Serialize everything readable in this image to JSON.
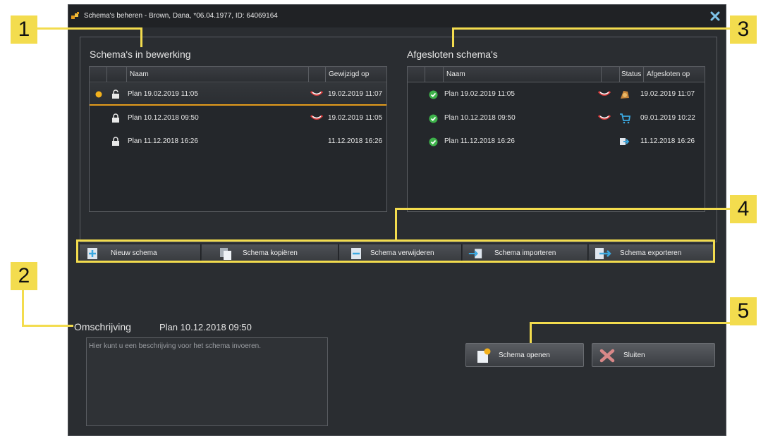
{
  "window": {
    "title": "Schema's beheren - Brown, Dana, *06.04.1977, ID: 64069164"
  },
  "left_section": {
    "title": "Schema's in bewerking",
    "columns": [
      "Naam",
      "Gewijzigd op"
    ],
    "rows": [
      {
        "name": "Plan 19.02.2019 11:05",
        "modified": "19.02.2019 11:07",
        "selected": true,
        "active_dot": true,
        "lock": "open",
        "denture_icon": true
      },
      {
        "name": "Plan 10.12.2018 09:50",
        "modified": "19.02.2019 11:05",
        "selected": false,
        "active_dot": false,
        "lock": "closed",
        "denture_icon": true
      },
      {
        "name": "Plan 11.12.2018 16:26",
        "modified": "11.12.2018 16:26",
        "selected": false,
        "active_dot": false,
        "lock": "closed",
        "denture_icon": false
      }
    ]
  },
  "right_section": {
    "title": "Afgesloten schema's",
    "columns": [
      "Naam",
      "Status",
      "Afgesloten op"
    ],
    "rows": [
      {
        "name": "Plan 19.02.2019 11:05",
        "status_icon": "print-icon",
        "closed": "19.02.2019 11:07",
        "denture_icon": true
      },
      {
        "name": "Plan 10.12.2018 09:50",
        "status_icon": "cart-icon",
        "closed": "09.01.2019 10:22",
        "denture_icon": true
      },
      {
        "name": "Plan 11.12.2018 16:26",
        "status_icon": "export-icon",
        "closed": "11.12.2018 16:26",
        "denture_icon": false
      }
    ]
  },
  "toolbar": {
    "new": "Nieuw schema",
    "copy": "Schema kopiëren",
    "delete": "Schema verwijderen",
    "import": "Schema importeren",
    "export": "Schema exporteren"
  },
  "description": {
    "label": "Omschrijving",
    "plan": "Plan 10.12.2018 09:50",
    "placeholder": "Hier kunt u een beschrijving voor het schema invoeren."
  },
  "buttons": {
    "open": "Schema openen",
    "close": "Sluiten"
  },
  "callouts": [
    "1",
    "2",
    "3",
    "4",
    "5"
  ],
  "colors": {
    "accent": "#e39b1c",
    "callout": "#f3dc4e",
    "check_green": "#3db24a"
  }
}
